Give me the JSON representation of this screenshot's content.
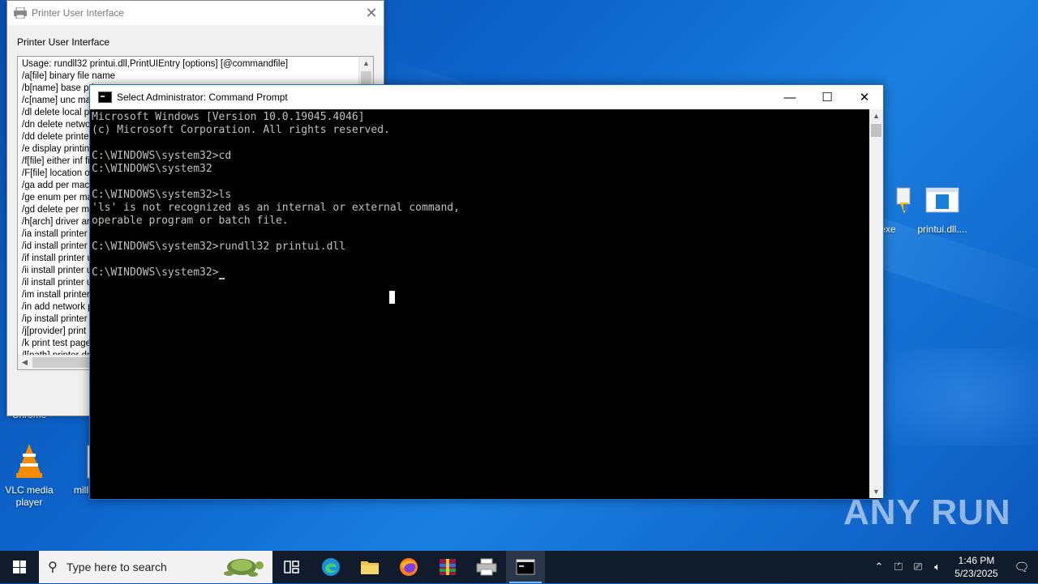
{
  "desktop": {
    "icons": [
      {
        "label": "i.exe"
      },
      {
        "label": "printui.dll...."
      },
      {
        "label": "Chrome"
      },
      {
        "label": "VLC media player"
      },
      {
        "label": "million"
      }
    ],
    "watermark": "ANY RUN"
  },
  "printer_ui": {
    "title": "Printer User Interface",
    "heading": "Printer User Interface",
    "lines": [
      "Usage: rundll32 printui.dll,PrintUIEntry [options] [@commandfile]",
      "   /a[file] binary file name",
      "   /b[name] base printer name",
      "   /c[name] unc machine name if the action is on a remote machine",
      "   /dl delete local printer",
      "   /dn delete network printer connection",
      "   /dd delete printer driver",
      "   /e display printing preferences",
      "   /f[file] either inf file or output file",
      "   /F[file] location of an INF file that the INF file specified with /f may depend on",
      "   /ga add per machine printer connections",
      "   /ge enum per machine printer connections",
      "   /gd delete per machine printer connections",
      "   /h[arch] driver architecture",
      "   /ia install printer driver using inf file",
      "   /id install printer driver using add printer driver wizard",
      "   /if install printer using inf file",
      "   /ii install printer using add printer wizard with an inf file",
      "   /il install printer using add printer wizard",
      "   /im install printer using add printer wizard with manual install",
      "   /in add network printer connection",
      "   /ip install printer using network printer installation wizard",
      "   /j[provider] print provider name",
      "   /k print test page to specified printer",
      "   /l[path] printer driver source path"
    ]
  },
  "cmd": {
    "title": "Select Administrator: Command Prompt",
    "minimize": "—",
    "maximize": "☐",
    "close": "✕",
    "lines": [
      "Microsoft Windows [Version 10.0.19045.4046]",
      "(c) Microsoft Corporation. All rights reserved.",
      "",
      "C:\\WINDOWS\\system32>cd",
      "C:\\WINDOWS\\system32",
      "",
      "C:\\WINDOWS\\system32>ls",
      "'ls' is not recognized as an internal or external command,",
      "operable program or batch file.",
      "",
      "C:\\WINDOWS\\system32>rundll32 printui.dll",
      "",
      "C:\\WINDOWS\\system32>"
    ]
  },
  "taskbar": {
    "search_placeholder": "Type here to search",
    "apps": [
      "task-view",
      "edge",
      "file-explorer",
      "firefox",
      "winrar",
      "printer",
      "command-prompt"
    ],
    "time": "1:46 PM",
    "date": "5/23/2025"
  },
  "colors": {
    "accent": "#76b9ed",
    "taskbar": "#101b2b",
    "console_text": "#c0c0c0"
  }
}
